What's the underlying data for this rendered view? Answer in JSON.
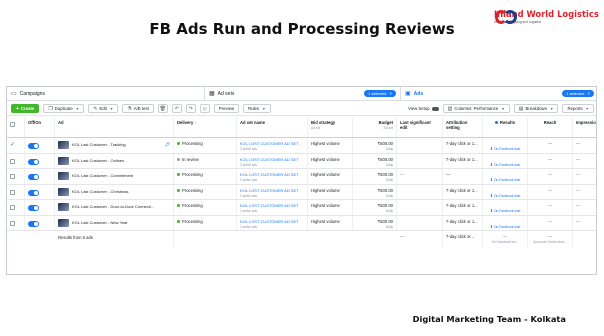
{
  "slide": {
    "title": "FB Ads Run and Processing Reviews",
    "footer": "Digital Marketing Team - Kolkata",
    "logo_name": "Inland World Logistics",
    "logo_tagline": "Integrated Shipping and Logistics"
  },
  "topbar": {
    "campaigns_label": "Campaigns",
    "adsets_label": "Ad sets",
    "adsets_pill": "1 selected",
    "ads_label": "Ads",
    "ads_pill": "1 selected"
  },
  "toolbar": {
    "create": "Create",
    "duplicate": "Duplicate",
    "edit": "Edit",
    "ab_test": "A/B test",
    "preview": "Preview",
    "rules": "Rules",
    "view_setup": "View Setup",
    "columns": "Columns: Performance",
    "breakdown": "Breakdown",
    "reports": "Reports"
  },
  "columns": {
    "offon": "Off/On",
    "ad": "Ad",
    "delivery": "Delivery",
    "adset_name": "Ad set name",
    "bid": "Bid strategy",
    "bid_sub": "Ad set",
    "budget": "Budget",
    "budget_sub": "Ad set",
    "last_edit": "Last significant edit",
    "attribution": "Attribution setting",
    "results": "Results",
    "reach": "Reach",
    "impressions": "Impressio"
  },
  "rows": [
    {
      "ad": "KOL Last Customer - Tracking",
      "delivery": "Processing",
      "adset": "KOL LOST CUSTOMER AD SET",
      "adset_sub": "2 active ads",
      "bid": "Highest volume",
      "budget": "₹500.00",
      "budget_sub": "Daily",
      "last": "",
      "attr": "7-day click or 1...",
      "res": "On-Facebook lead",
      "reach": "—",
      "impr": "—",
      "status_color": "green"
    },
    {
      "ad": "KOL Last Customer - Onlines",
      "delivery": "In review",
      "adset": "KOL LOST CUSTOMER AD SET",
      "adset_sub": "2 active ads",
      "bid": "Highest volume",
      "budget": "₹500.00",
      "budget_sub": "Daily",
      "last": "",
      "attr": "7-day click or 1...",
      "res": "On-Facebook lead",
      "reach": "—",
      "impr": "—",
      "status_color": "grey"
    },
    {
      "ad": "KOL Last Customer - Commitment",
      "delivery": "Processing",
      "adset": "KOL LOST CUSTOMER AD SET",
      "adset_sub": "2 active ads",
      "bid": "Highest volume",
      "budget": "₹500.00",
      "budget_sub": "Daily",
      "last": "—",
      "attr": "—",
      "res": "On-Facebook lead",
      "reach": "—",
      "impr": "—",
      "status_color": "green"
    },
    {
      "ad": "KOL Last Customer - Christmas",
      "delivery": "Processing",
      "adset": "KOL LOST CUSTOMER AD SET",
      "adset_sub": "2 active ads",
      "bid": "Highest volume",
      "budget": "₹500.00",
      "budget_sub": "Daily",
      "last": "",
      "attr": "7-day click or 1...",
      "res": "On-Facebook lead",
      "reach": "—",
      "impr": "—",
      "status_color": "green"
    },
    {
      "ad": "KOL Last Customer - Door-to-Door Connecti...",
      "delivery": "Processing",
      "adset": "KOL LOST CUSTOMER AD SET",
      "adset_sub": "2 active ads",
      "bid": "Highest volume",
      "budget": "₹500.00",
      "budget_sub": "Daily",
      "last": "",
      "attr": "7-day click or 1...",
      "res": "On-Facebook lead",
      "reach": "—",
      "impr": "—",
      "status_color": "green"
    },
    {
      "ad": "KOL Last Customer - New Year",
      "delivery": "Processing",
      "adset": "KOL LOST CUSTOMER AD SET",
      "adset_sub": "2 active ads",
      "bid": "Highest volume",
      "budget": "₹500.00",
      "budget_sub": "Daily",
      "last": "",
      "attr": "7-day click or 1...",
      "res": "On-Facebook lead",
      "reach": "—",
      "impr": "—",
      "status_color": "green"
    }
  ],
  "totals": {
    "label": "Results from 6 ads",
    "last": "—",
    "attr": "7-day click or...",
    "res": "—",
    "res_sub": "On-Facebook lea...",
    "reach": "—",
    "reach_sub": "Accounts Centre acco..."
  }
}
